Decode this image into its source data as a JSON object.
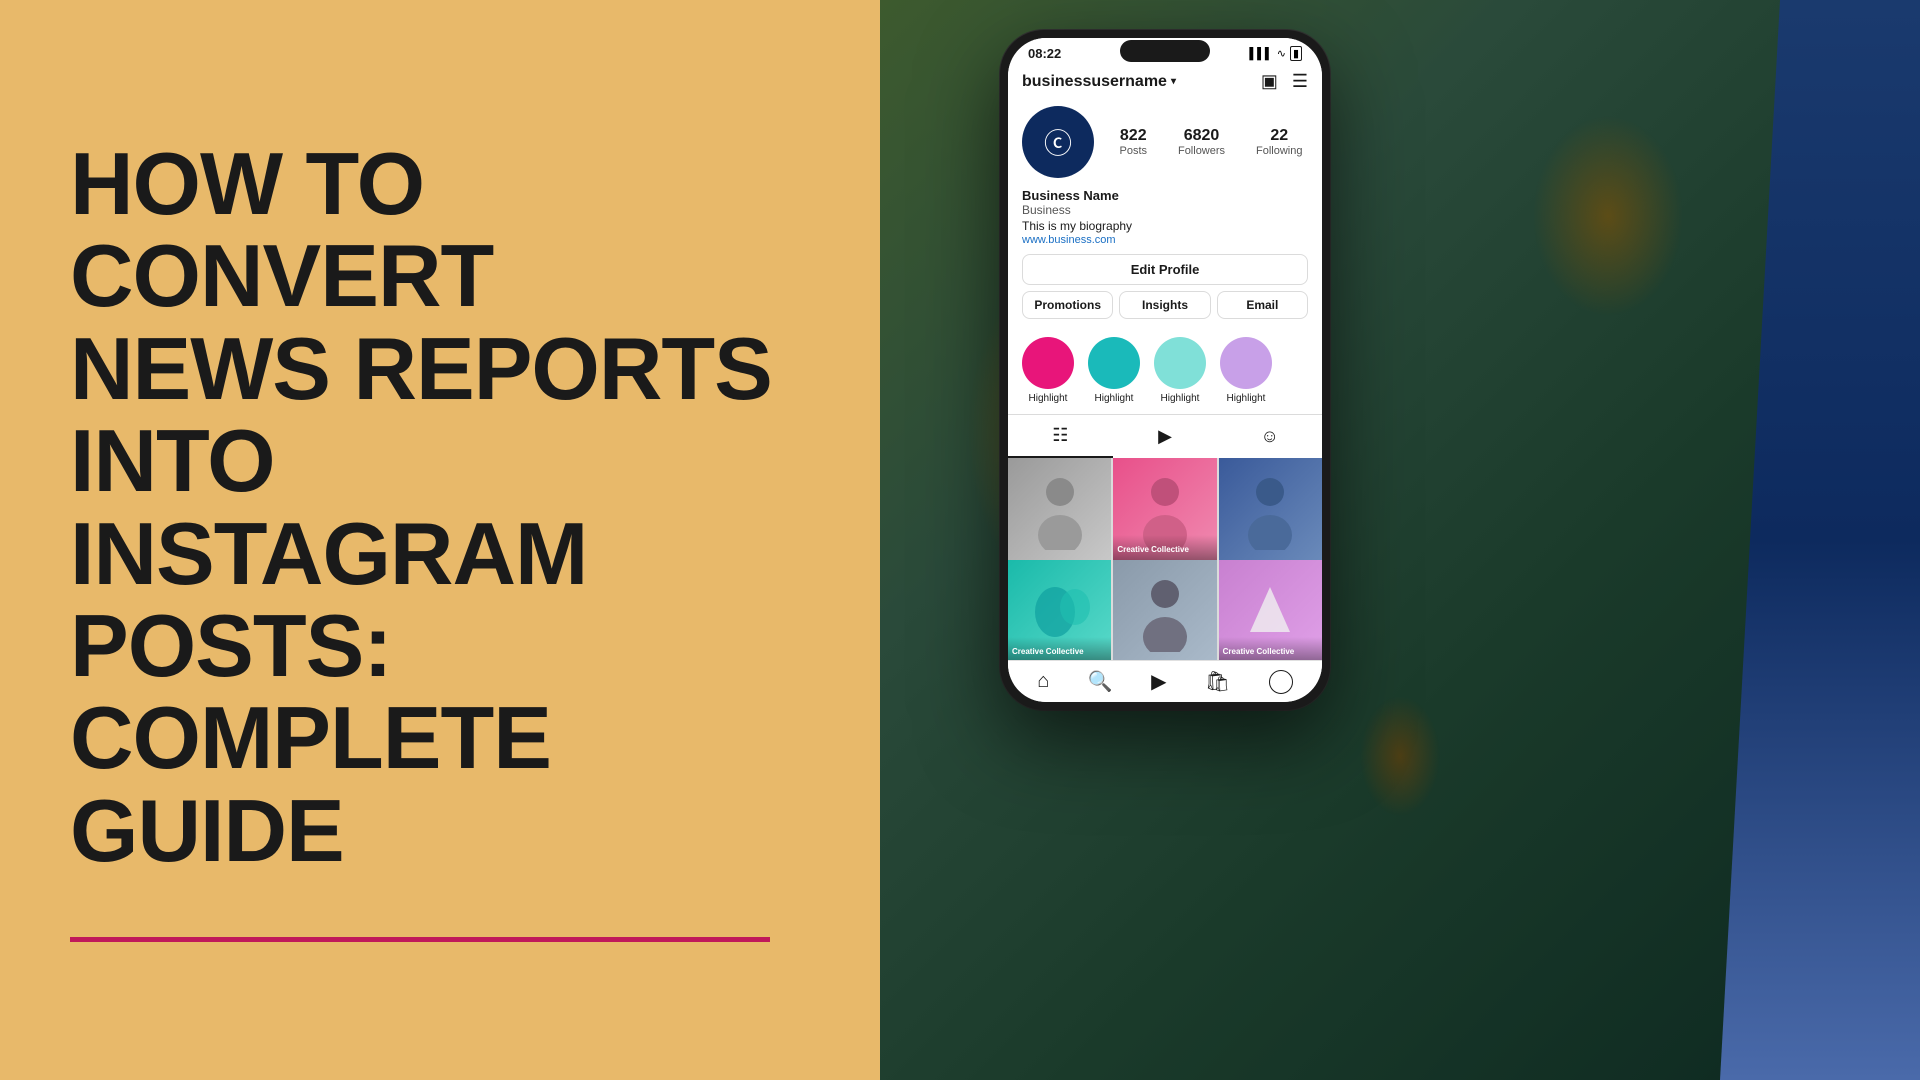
{
  "left": {
    "title_line1": "HOW TO CONVERT",
    "title_line2": "NEWS REPORTS INTO",
    "title_line3": "INSTAGRAM POSTS:",
    "title_line4": "COMPLETE GUIDE",
    "bg_color": "#E8B96A",
    "accent_color": "#c0185a"
  },
  "phone": {
    "time": "08:22",
    "username": "businessusername",
    "stats": [
      {
        "number": "822",
        "label": "Posts"
      },
      {
        "number": "6820",
        "label": "Followers"
      },
      {
        "number": "22",
        "label": "Following"
      }
    ],
    "profile_name": "Business Name",
    "profile_category": "Business",
    "profile_bio": "This is my biography",
    "profile_link": "www.business.com",
    "edit_profile_label": "Edit Profile",
    "action_buttons": [
      "Promotions",
      "Insights",
      "Email"
    ],
    "highlights": [
      {
        "label": "Highlight",
        "color": "#e8157a"
      },
      {
        "label": "Highlight",
        "color": "#1ababa"
      },
      {
        "label": "Highlight",
        "color": "#80e0d8"
      },
      {
        "label": "Highlight",
        "color": "#c8a0e8"
      }
    ],
    "tabs": [
      "grid",
      "reels",
      "tagged"
    ],
    "grid_cells": [
      {
        "type": "person",
        "bg": "#b0b0b0",
        "overlay": ""
      },
      {
        "type": "person",
        "bg": "#e8508a",
        "overlay": "Creative Collective"
      },
      {
        "type": "person",
        "bg": "#4a6a9a",
        "overlay": ""
      },
      {
        "type": "abstract",
        "bg": "#1ababa",
        "overlay": "Creative Collective"
      },
      {
        "type": "person",
        "bg": "#8a9aaa",
        "overlay": ""
      },
      {
        "type": "abstract",
        "bg": "#c880d0",
        "overlay": "Creative Collective"
      }
    ],
    "nav_icons": [
      "home",
      "search",
      "reels",
      "shop",
      "profile"
    ]
  }
}
